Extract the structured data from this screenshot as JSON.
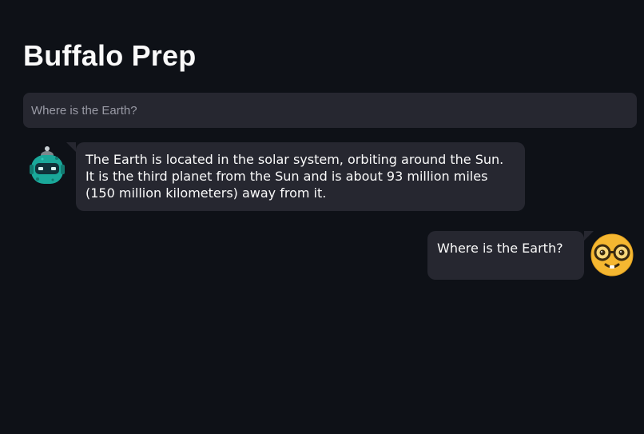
{
  "app": {
    "title": "Buffalo Prep"
  },
  "prompt_input": {
    "placeholder": "Where is the Earth?",
    "value": ""
  },
  "messages": [
    {
      "role": "assistant",
      "avatar": "robot-avatar-icon",
      "text": "The Earth is located in the solar system, orbiting around the Sun. It is the third planet from the Sun and is about 93 million miles (150 million kilometers) away from it."
    },
    {
      "role": "user",
      "avatar": "nerd-face-avatar-icon",
      "text": "Where is the Earth?"
    }
  ],
  "colors": {
    "background": "#0e1117",
    "bubble": "#262730",
    "bot_avatar": "#1aa89a",
    "user_avatar": "#f5b731"
  }
}
